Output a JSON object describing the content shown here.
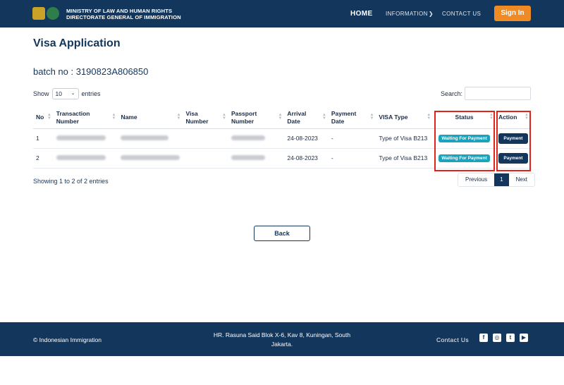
{
  "header": {
    "org_line1": "MINISTRY OF LAW AND HUMAN RIGHTS",
    "org_line2": "DIRECTORATE GENERAL OF IMMIGRATION",
    "nav": {
      "home": "HOME",
      "information": "INFORMATION",
      "contact": "CONTACT US"
    },
    "signin_label": "Sign In"
  },
  "page": {
    "title": "Visa Application",
    "batch": "batch no : 3190823A806850"
  },
  "table_controls": {
    "show_label": "Show",
    "entries_value": "10",
    "entries_label": "entries",
    "search_label": "Search:"
  },
  "table": {
    "headers": [
      "No",
      "Transaction Number",
      "Name",
      "Visa Number",
      "Passport Number",
      "Arrival Date",
      "Payment Date",
      "VISA Type",
      "Status",
      "Action"
    ],
    "rows": [
      {
        "no": "1",
        "visa_number": "",
        "arrival": "24-08-2023",
        "payment_date": "-",
        "visa_type": "Type of Visa B213",
        "status": "Waiting For Payment",
        "action": "Payment"
      },
      {
        "no": "2",
        "visa_number": "",
        "arrival": "24-08-2023",
        "payment_date": "-",
        "visa_type": "Type of Visa B213",
        "status": "Waiting For Payment",
        "action": "Payment"
      }
    ]
  },
  "pagination": {
    "summary": "Showing 1 to 2 of 2 entries",
    "previous": "Previous",
    "current": "1",
    "next": "Next"
  },
  "back_label": "Back",
  "footer": {
    "copyright": "© Indonesian Immigration",
    "address_line1": "HR. Rasuna Said Blok X-6, Kav 8, Kuningan, South",
    "address_line2": "Jakarta.",
    "contact": "Contact Us",
    "social": [
      "facebook-icon",
      "instagram-icon",
      "twitter-icon",
      "youtube-icon"
    ]
  },
  "colors": {
    "navy": "#13365c",
    "orange": "#f08a24",
    "status_teal": "#1aa3bd",
    "highlight_red": "#e2231a"
  }
}
